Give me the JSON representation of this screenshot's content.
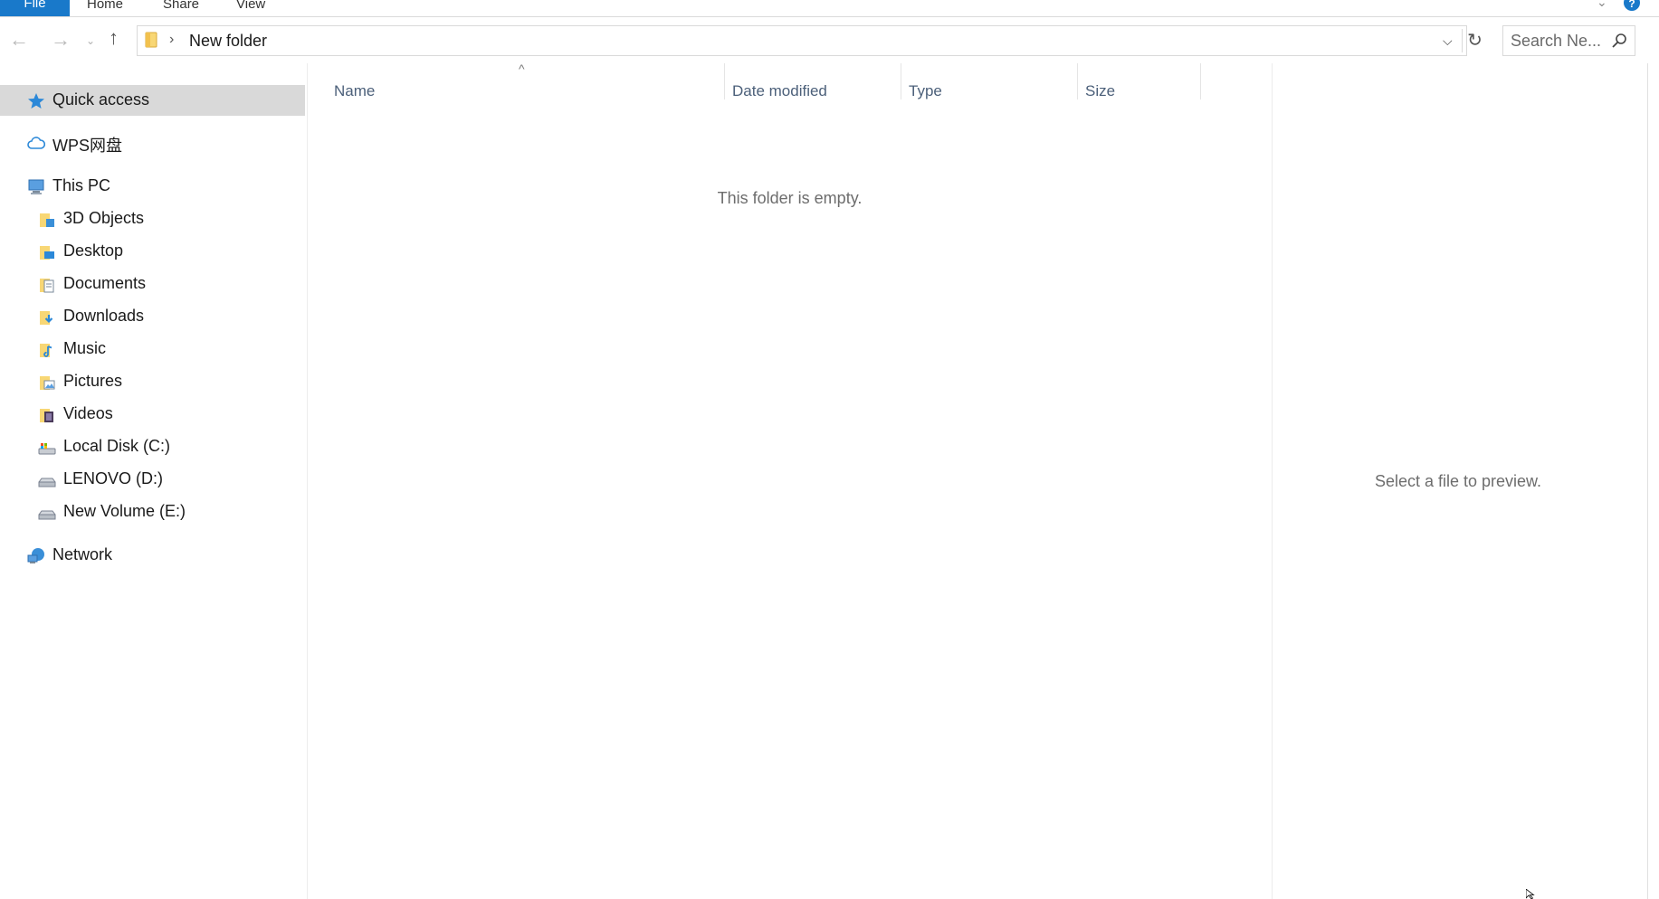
{
  "ribbon": {
    "tabs": [
      "File",
      "Home",
      "Share",
      "View"
    ],
    "help_label": "?"
  },
  "navigation": {
    "current_folder": "New folder",
    "search_placeholder": "Search Ne..."
  },
  "sidebar": {
    "quick_access": "Quick access",
    "wps_cloud": "WPS网盘",
    "this_pc": "This PC",
    "items": [
      "3D Objects",
      "Desktop",
      "Documents",
      "Downloads",
      "Music",
      "Pictures",
      "Videos",
      "Local Disk (C:)",
      "LENOVO (D:)",
      "New Volume (E:)"
    ],
    "network": "Network"
  },
  "content": {
    "columns": [
      "Name",
      "Date modified",
      "Type",
      "Size"
    ],
    "empty_message": "This folder is empty."
  },
  "preview": {
    "message": "Select a file to preview."
  },
  "colors": {
    "accent": "#1979ca",
    "selected_bg": "#d9d9d9",
    "folder_yellow": "#f8d775",
    "header_text": "#4c607a"
  },
  "icons": {
    "back": "arrow-left-icon",
    "forward": "arrow-right-icon",
    "up": "arrow-up-icon",
    "refresh": "refresh-icon",
    "search": "search-icon"
  }
}
